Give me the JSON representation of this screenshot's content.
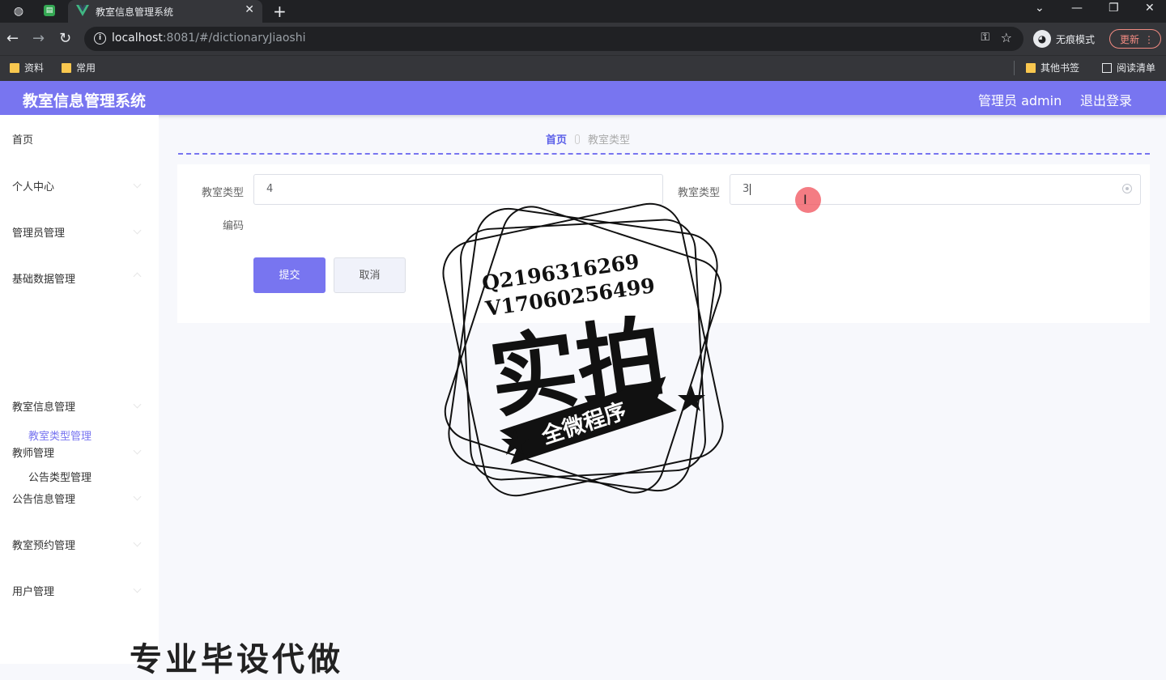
{
  "browser": {
    "tab_title": "教室信息管理系统",
    "url_host": "localhost",
    "url_rest": ":8081/#/dictionaryJiaoshi",
    "incognito_label": "无痕模式",
    "update_label": "更新",
    "bookmarks": [
      "资料",
      "常用"
    ],
    "bookmarks_right": [
      "其他书签",
      "阅读清单"
    ]
  },
  "header": {
    "title": "教室信息管理系统",
    "user": "管理员 admin",
    "logout": "退出登录"
  },
  "sidebar": {
    "items": [
      {
        "label": "首页"
      },
      {
        "label": "个人中心"
      },
      {
        "label": "管理员管理"
      },
      {
        "label": "基础数据管理"
      },
      {
        "label": "教室信息管理"
      },
      {
        "label": "教师管理"
      },
      {
        "label": "公告信息管理"
      },
      {
        "label": "教室预约管理"
      },
      {
        "label": "用户管理"
      }
    ],
    "subitems": [
      {
        "label": "教室类型管理"
      },
      {
        "label": "公告类型管理"
      }
    ]
  },
  "breadcrumb": {
    "home": "首页",
    "current": "教室类型"
  },
  "form": {
    "field1_label_a": "教室类型",
    "field1_label_b": "编码",
    "field1_value": "4",
    "field2_label": "教室类型",
    "field2_value": "3",
    "submit": "提交",
    "cancel": "取消"
  },
  "watermark": {
    "line1": "Q2196316269",
    "line2": "V17060256499",
    "big": "实拍",
    "banner": "全微程序",
    "bottom": "专业毕设代做"
  },
  "colors": {
    "primary": "#7875f0",
    "breadcrumb_home": "#5b5fe8"
  }
}
